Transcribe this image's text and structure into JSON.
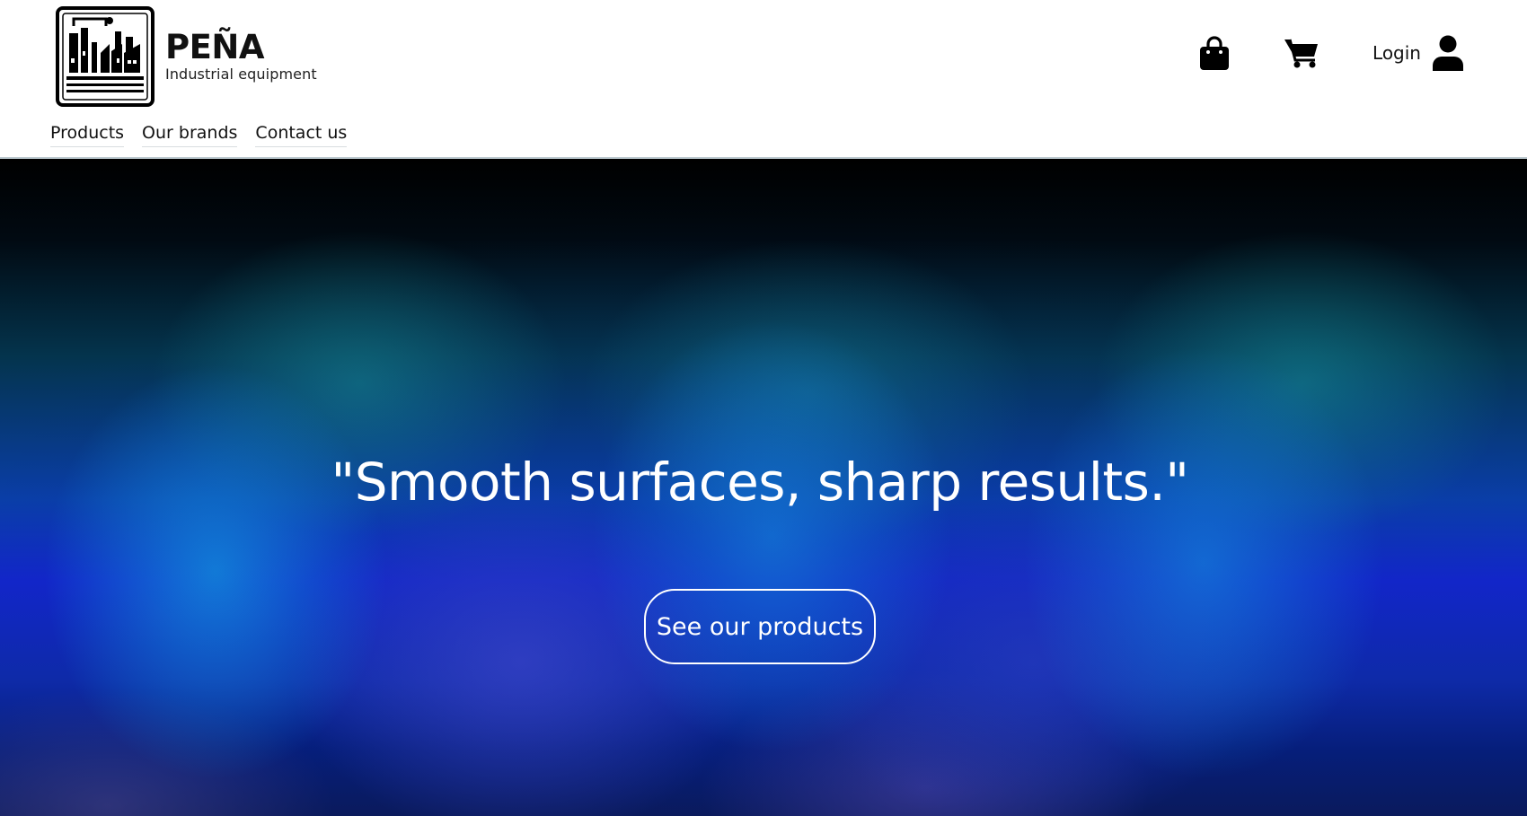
{
  "brand": {
    "name": "PEÑA",
    "tagline": "Industrial equipment",
    "logo_icon": "factory-icon"
  },
  "nav": {
    "items": [
      {
        "label": "Products"
      },
      {
        "label": "Our brands"
      },
      {
        "label": "Contact us"
      }
    ]
  },
  "actions": {
    "bag_icon": "shopping-bag-icon",
    "cart_icon": "shopping-cart-icon",
    "login_label": "Login",
    "user_icon": "user-icon"
  },
  "hero": {
    "quote": "\"Smooth surfaces, sharp results.\"",
    "cta_label": "See our products",
    "colors": {
      "top": "#000000",
      "teal": "#148c96",
      "blue": "#1226c9",
      "highlight": "#128cdc"
    }
  }
}
